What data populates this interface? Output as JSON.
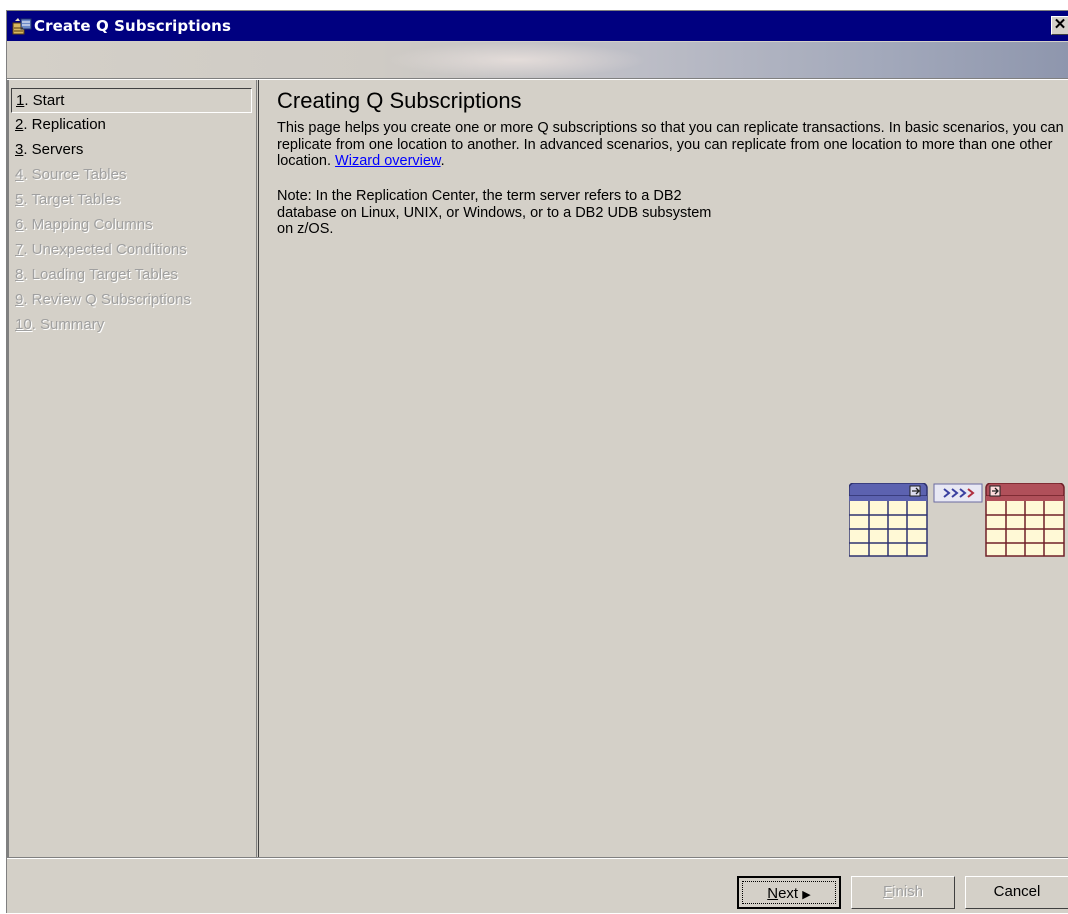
{
  "window": {
    "title": "Create Q Subscriptions",
    "close_label": "✕"
  },
  "sidebar": {
    "items": [
      {
        "num": "1",
        "label": ". Start",
        "state": "current"
      },
      {
        "num": "2",
        "label": ". Replication",
        "state": "enabled"
      },
      {
        "num": "3",
        "label": ". Servers",
        "state": "enabled"
      },
      {
        "num": "4",
        "label": ". Source Tables",
        "state": "disabled"
      },
      {
        "num": "5",
        "label": ". Target Tables",
        "state": "disabled"
      },
      {
        "num": "6",
        "label": ". Mapping Columns",
        "state": "disabled"
      },
      {
        "num": "7",
        "label": ". Unexpected Conditions",
        "state": "disabled"
      },
      {
        "num": "8",
        "label": ". Loading Target Tables",
        "state": "disabled"
      },
      {
        "num": "9",
        "label": ". Review Q Subscriptions",
        "state": "disabled"
      },
      {
        "num": "10",
        "label": ". Summary",
        "state": "disabled"
      }
    ]
  },
  "main": {
    "heading": "Creating Q Subscriptions",
    "description": "This page helps you create one or more Q subscriptions so that you can replicate transactions. In basic scenarios, you can replicate from one location to another.  In advanced scenarios, you can replicate from one location to more than one other location. ",
    "overview_link": "Wizard overview",
    "overview_suffix": ".",
    "note_line1": "Note:  In the Replication Center, the term server refers to a DB2",
    "note_line2": "database on Linux, UNIX, or Windows, or to a DB2 UDB subsystem",
    "note_line3": "on z/OS."
  },
  "footer": {
    "next_mnemonic": "N",
    "next_rest": "ext",
    "next_arrow": "▶",
    "finish_mnemonic": "F",
    "finish_rest": "inish",
    "cancel_label": "Cancel"
  },
  "colors": {
    "title_bar": "#000080",
    "dialog_bg": "#d4d0c8",
    "source_table_header": "#5c62b0",
    "target_table_header": "#b0505a",
    "table_body": "#fff9d6",
    "link": "#0000ff"
  },
  "icons": {
    "app": "wizard-icon",
    "close": "close-icon",
    "graphic": "replication-tables-icon"
  }
}
